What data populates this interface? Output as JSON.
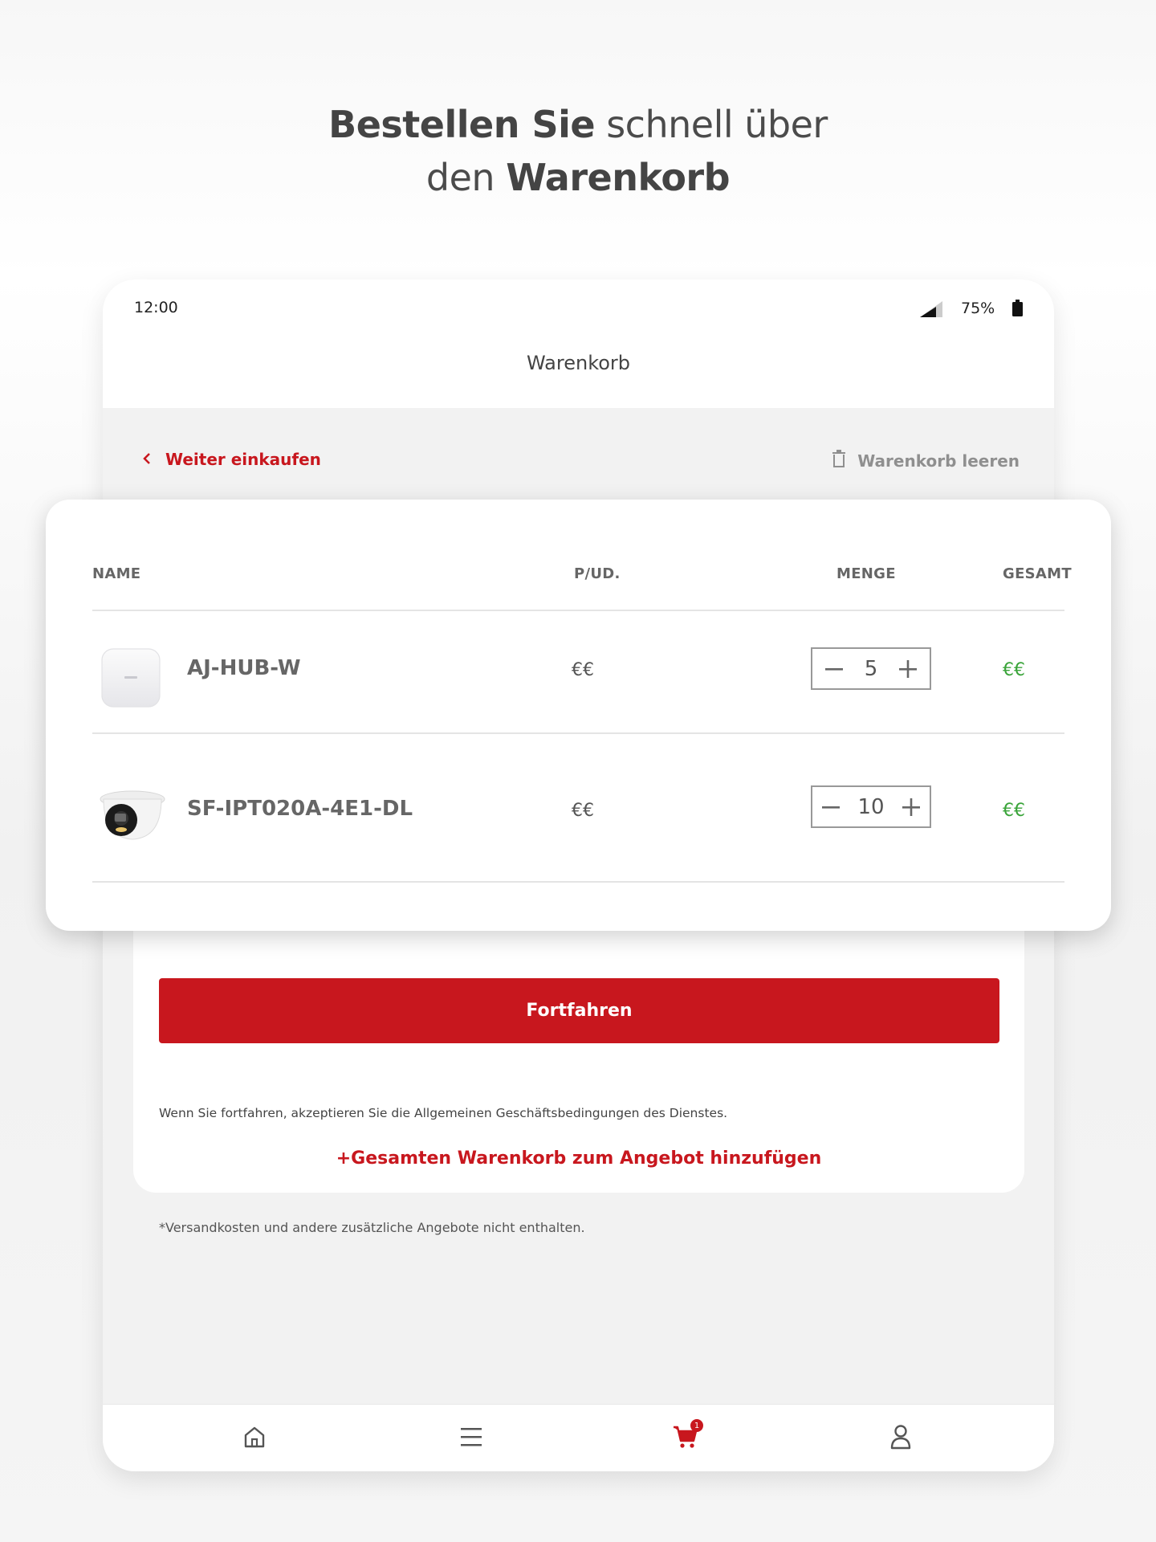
{
  "headline": {
    "line1_bold": "Bestellen Sie",
    "line1_rest": " schnell über",
    "line2_start": "den ",
    "line2_bold": "Warenkorb"
  },
  "status_bar": {
    "time": "12:00",
    "battery": "75%"
  },
  "app_bar": {
    "title": "Warenkorb"
  },
  "sub_nav": {
    "back_label": "Weiter einkaufen",
    "clear_label": "Warenkorb leeren"
  },
  "table": {
    "headers": {
      "name": "NAME",
      "unit_price": "P/UD.",
      "quantity": "MENGE",
      "total": "GESAMT"
    },
    "rows": [
      {
        "name": "AJ-HUB-W",
        "unit_price": "€€",
        "quantity": "5",
        "total": "€€"
      },
      {
        "name": "SF-IPT020A-4E1-DL",
        "unit_price": "€€",
        "quantity": "10",
        "total": "€€"
      }
    ]
  },
  "footer": {
    "disclaimer": "*Versandkosten und andere zusätzliche Angebote nicht enthalten.",
    "continue_label": "Fortfahren",
    "terms": "Wenn Sie fortfahren, akzeptieren Sie die Allgemeinen Geschäftsbedingungen des Dienstes.",
    "add_to_offer": "+Gesamten Warenkorb zum Angebot hinzufügen"
  },
  "bottom_nav": {
    "cart_badge": "1"
  },
  "colors": {
    "accent": "#c8171e",
    "total_green": "#3aa43a"
  }
}
